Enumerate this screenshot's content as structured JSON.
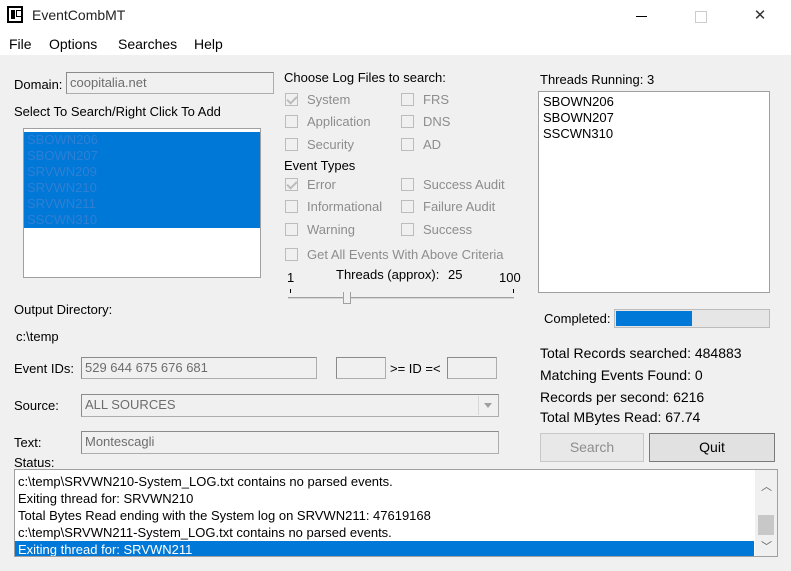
{
  "window": {
    "title": "EventCombMT"
  },
  "menu": [
    "File",
    "Options",
    "Searches",
    "Help"
  ],
  "domain": {
    "label": "Domain:",
    "value": "coopitalia.net"
  },
  "server_list": {
    "label": "Select To Search/Right Click To Add",
    "items": [
      "SBOWN206",
      "SBOWN207",
      "SRVWN209",
      "SRVWN210",
      "SRVWN211",
      "SSCWN310"
    ]
  },
  "log_files": {
    "label": "Choose Log Files to search:",
    "options": [
      {
        "label": "System",
        "checked": true
      },
      {
        "label": "FRS",
        "checked": false
      },
      {
        "label": "Application",
        "checked": false
      },
      {
        "label": "DNS",
        "checked": false
      },
      {
        "label": "Security",
        "checked": false
      },
      {
        "label": "AD",
        "checked": false
      }
    ]
  },
  "event_types": {
    "label": "Event Types",
    "options": [
      {
        "label": "Error",
        "checked": true
      },
      {
        "label": "Success Audit",
        "checked": false
      },
      {
        "label": "Informational",
        "checked": false
      },
      {
        "label": "Failure Audit",
        "checked": false
      },
      {
        "label": "Warning",
        "checked": false
      },
      {
        "label": "Success",
        "checked": false
      }
    ],
    "get_all": {
      "label": "Get All Events With Above Criteria",
      "checked": false
    }
  },
  "threads_slider": {
    "min": "1",
    "max": "100",
    "label": "Threads (approx):",
    "value": "25"
  },
  "threads_running": {
    "label": "Threads Running: 3",
    "items": [
      "SBOWN206",
      "SBOWN207",
      "SSCWN310"
    ]
  },
  "output_dir": {
    "label": "Output Directory:",
    "value": "c:\\temp"
  },
  "completed": {
    "label": "Completed:",
    "progress": 0.5
  },
  "stats": {
    "total_records": "Total Records searched: 484883",
    "matching": "Matching Events Found: 0",
    "per_second": "Records per second: 6216",
    "mbytes": "Total MBytes Read: 67.74"
  },
  "event_ids": {
    "label": "Event IDs:",
    "value": "529 644 675 676 681",
    "range_min": "",
    "range_label": ">= ID =<",
    "range_max": ""
  },
  "source": {
    "label": "Source:",
    "value": "ALL SOURCES"
  },
  "text": {
    "label": "Text:",
    "value": "Montescagli"
  },
  "buttons": {
    "search": "Search",
    "quit": "Quit"
  },
  "status": {
    "label": "Status:",
    "lines": [
      "c:\\temp\\SRVWN210-System_LOG.txt contains no parsed events.",
      "Exiting thread for: SRVWN210",
      "Total Bytes Read ending with the System log on SRVWN211: 47619168",
      "c:\\temp\\SRVWN211-System_LOG.txt contains no parsed events.",
      "Exiting thread for: SRVWN211"
    ]
  },
  "colors": {
    "selection": "#0078d7",
    "window_bg": "#f0f0f0"
  }
}
